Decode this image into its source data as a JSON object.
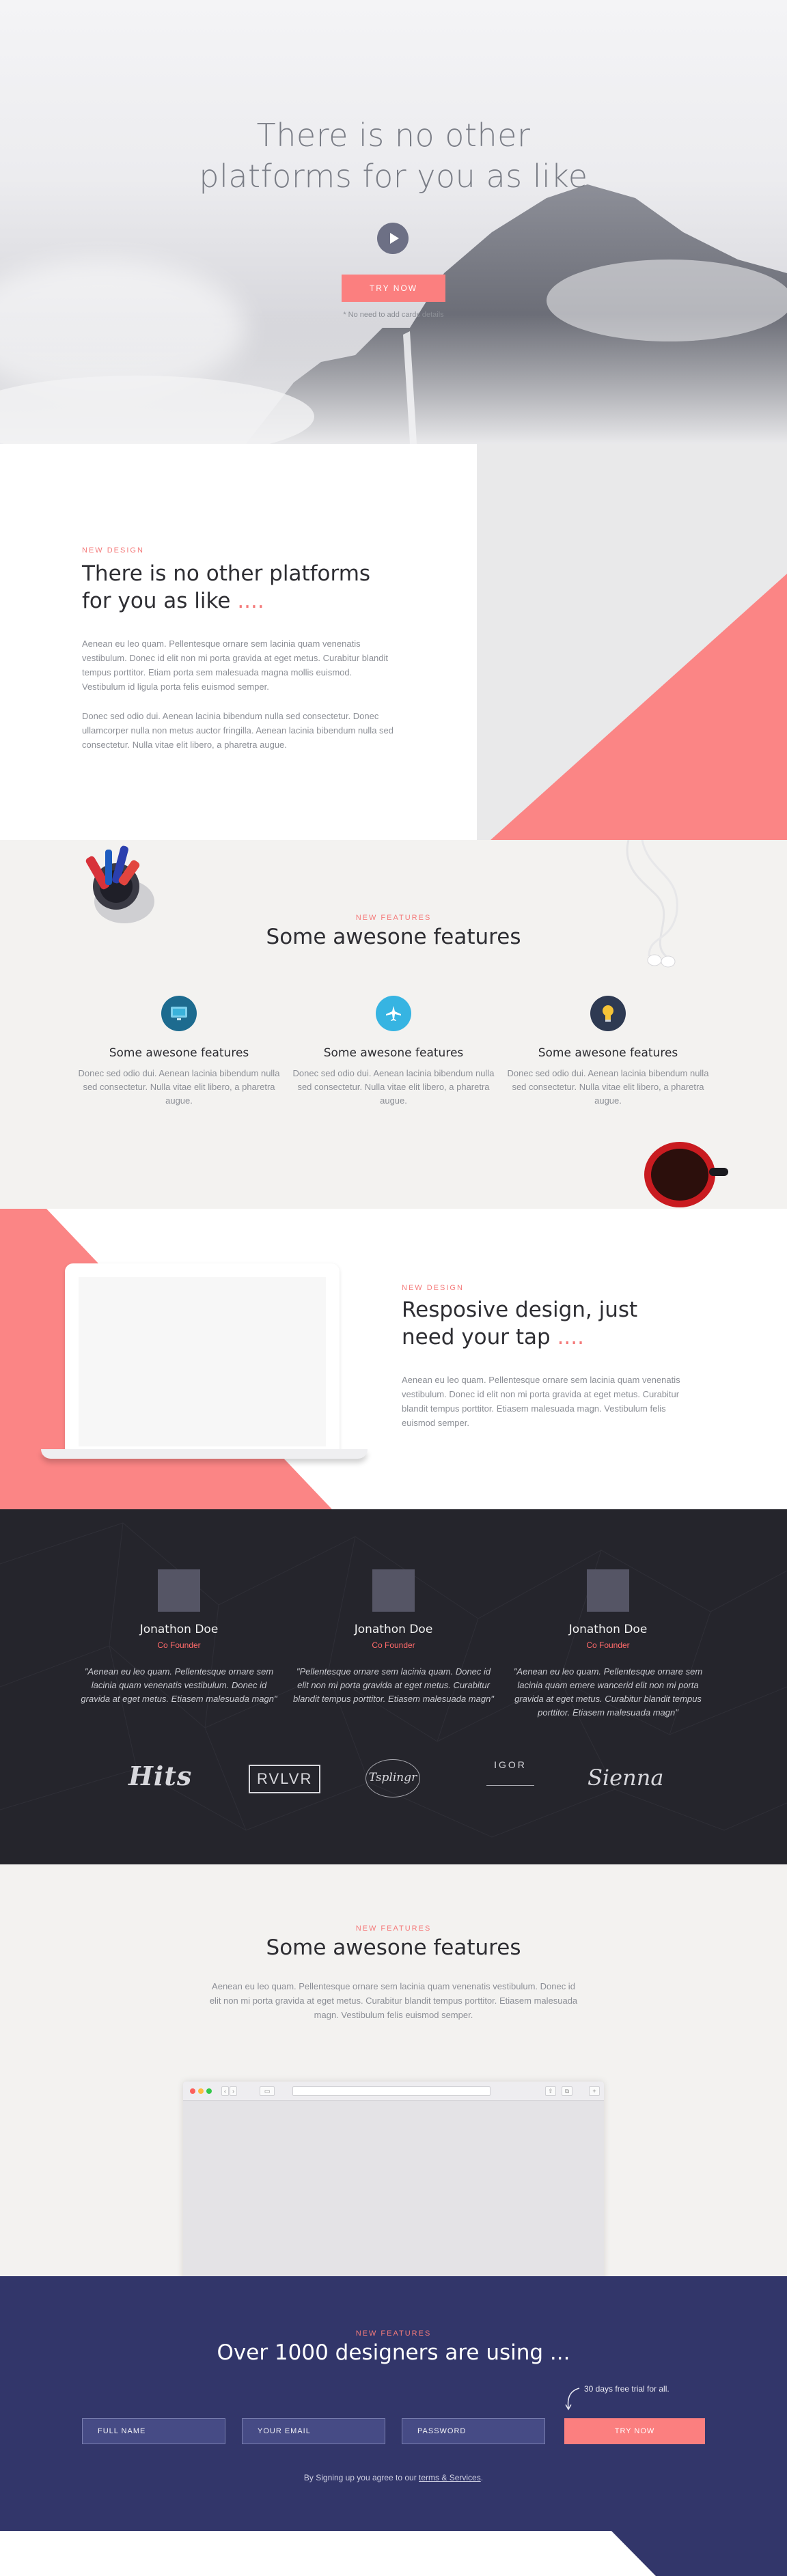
{
  "hero": {
    "title_line1": "There is no other",
    "title_line2": "platforms for you as like",
    "play_icon": "play-icon",
    "button_label": "TRY NOW",
    "note": "* No need to add cards details"
  },
  "intro": {
    "eyebrow": "NEW DESIGN",
    "heading_line1": "There is no other platforms",
    "heading_line2": "for you as like",
    "heading_dots": "....",
    "paragraph1": "Aenean eu leo quam. Pellentesque ornare sem lacinia quam venenatis vestibulum. Donec id elit non mi porta gravida at eget metus. Curabitur blandit tempus porttitor. Etiam porta sem malesuada magna mollis euismod. Vestibulum id ligula porta felis euismod semper.",
    "paragraph2": "Donec sed odio dui. Aenean lacinia bibendum nulla sed consectetur. Donec ullamcorper nulla non metus auctor fringilla. Aenean lacinia bibendum nulla sed consectetur. Nulla vitae elit libero, a pharetra augue."
  },
  "features": {
    "eyebrow": "NEW FEATURES",
    "heading": "Some awesone features",
    "items": [
      {
        "icon": "monitor-icon",
        "title": "Some awesone features",
        "text": "Donec sed odio dui. Aenean lacinia bibendum nulla sed consectetur. Nulla vitae elit libero, a pharetra augue."
      },
      {
        "icon": "airplane-icon",
        "title": "Some awesone features",
        "text": "Donec sed odio dui. Aenean lacinia bibendum nulla sed consectetur. Nulla vitae elit libero, a pharetra augue."
      },
      {
        "icon": "lightbulb-icon",
        "title": "Some awesone features",
        "text": "Donec sed odio dui. Aenean lacinia bibendum nulla sed consectetur. Nulla vitae elit libero, a pharetra augue."
      }
    ]
  },
  "responsive": {
    "eyebrow": "NEW DESIGN",
    "heading_line1": "Resposive design, just",
    "heading_line2": "need your tap",
    "heading_dots": "....",
    "paragraph": "Aenean eu leo quam. Pellentesque ornare sem lacinia quam venenatis vestibulum. Donec id elit non mi porta gravida at eget metus. Curabitur blandit tempus porttitor. Etiasem malesuada magn. Vestibulum felis euismod semper."
  },
  "team": {
    "members": [
      {
        "name": "Jonathon Doe",
        "role": "Co Founder",
        "quote": "\"Aenean eu leo quam. Pellentesque ornare sem lacinia quam venenatis vestibulum. Donec id gravida at eget metus. Etiasem malesuada magn\""
      },
      {
        "name": "Jonathon Doe",
        "role": "Co Founder",
        "quote": "\"Pellentesque ornare sem lacinia quam. Donec id elit non mi porta gravida at eget metus. Curabitur blandit tempus porttitor. Etiasem malesuada magn\""
      },
      {
        "name": "Jonathon Doe",
        "role": "Co Founder",
        "quote": "\"Aenean eu leo quam. Pellentesque ornare sem lacinia quam emere wancerid elit non mi porta gravida at eget metus. Curabitur blandit tempus porttitor. Etiasem malesuada magn\""
      }
    ],
    "logos": {
      "hits": "Hits",
      "rvlvr": "RVLVR",
      "tsplingr": "Tsplingr",
      "igor": "IGOR",
      "sienna": "Sienna"
    }
  },
  "showcase": {
    "eyebrow": "NEW FEATURES",
    "heading": "Some awesone features",
    "paragraph": "Aenean eu leo quam. Pellentesque ornare sem lacinia quam venenatis vestibulum. Donec id elit non mi porta gravida at eget metus. Curabitur blandit tempus porttitor. Etiasem malesuada magn. Vestibulum felis euismod semper."
  },
  "signup": {
    "eyebrow": "NEW FEATURES",
    "heading": "Over 1000 designers are using ...",
    "trial_note": "30 days free trial for all.",
    "name_placeholder": "FULL NAME",
    "email_placeholder": "YOUR EMAIL",
    "password_placeholder": "PASSWORD",
    "button_label": "TRY NOW",
    "terms_prefix": "By Signing up you agree to our",
    "terms_link": "terms & Services",
    "terms_suffix": "."
  },
  "colors": {
    "accent": "#fb7f7f",
    "navy": "#32366a",
    "dark": "#25252c"
  }
}
